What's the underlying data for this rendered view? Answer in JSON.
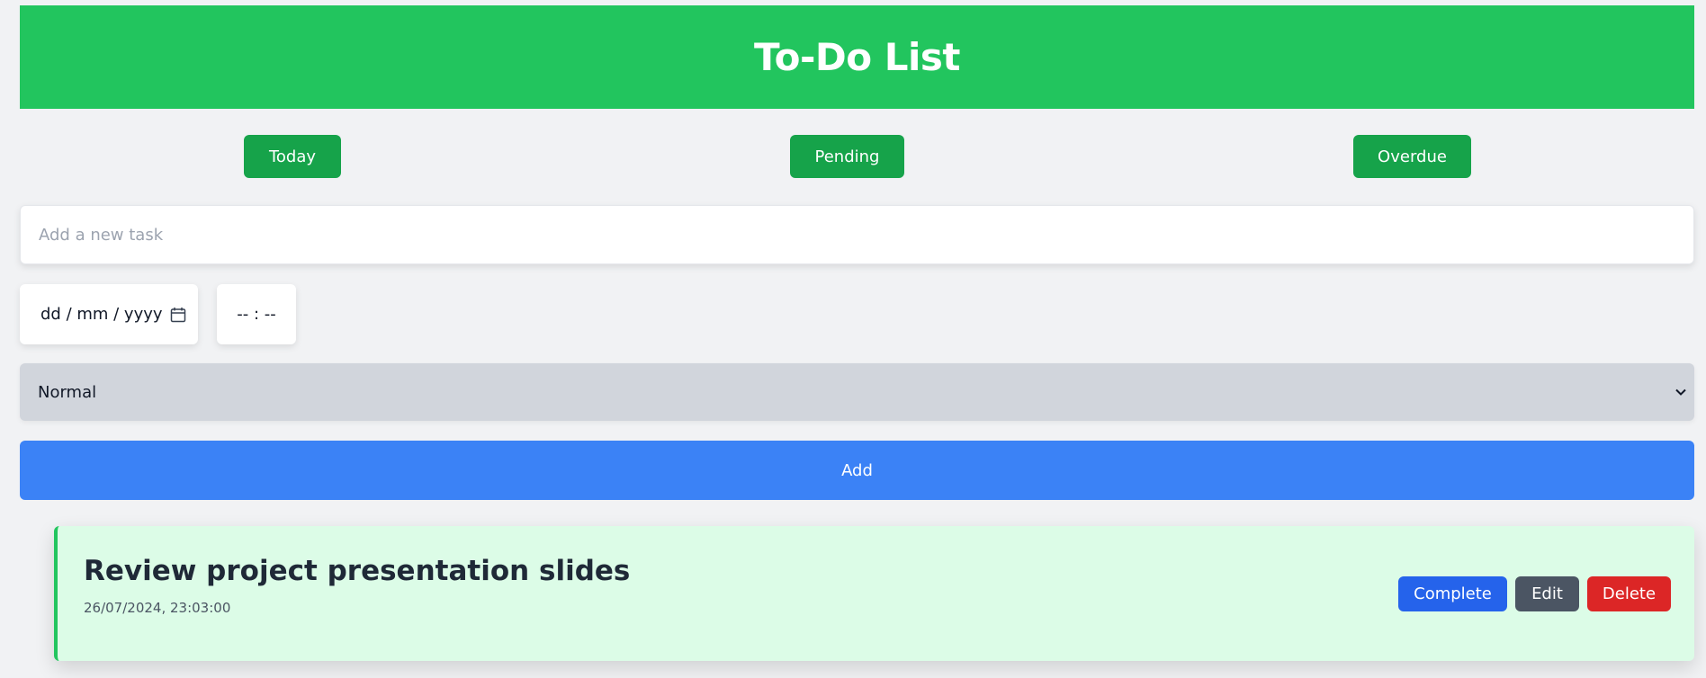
{
  "header": {
    "title": "To-Do List"
  },
  "filters": {
    "today": "Today",
    "pending": "Pending",
    "overdue": "Overdue"
  },
  "form": {
    "task_placeholder": "Add a new task",
    "task_value": "",
    "date_placeholder": "dd / mm / yyyy",
    "time_placeholder": "-- : --",
    "priority_selected": "Normal",
    "add_label": "Add"
  },
  "tasks": [
    {
      "title": "Review project presentation slides",
      "datetime": "26/07/2024, 23:03:00",
      "complete_label": "Complete",
      "edit_label": "Edit",
      "delete_label": "Delete"
    }
  ],
  "icons": {
    "date": "calendar-icon",
    "select": "chevron-down-icon"
  },
  "colors": {
    "header": "#22c55e",
    "filter_button": "#16a34a",
    "add_button": "#3b82f6",
    "complete_button": "#2563eb",
    "edit_button": "#4b5563",
    "delete_button": "#dc2626",
    "task_card": "#dcfce7"
  }
}
